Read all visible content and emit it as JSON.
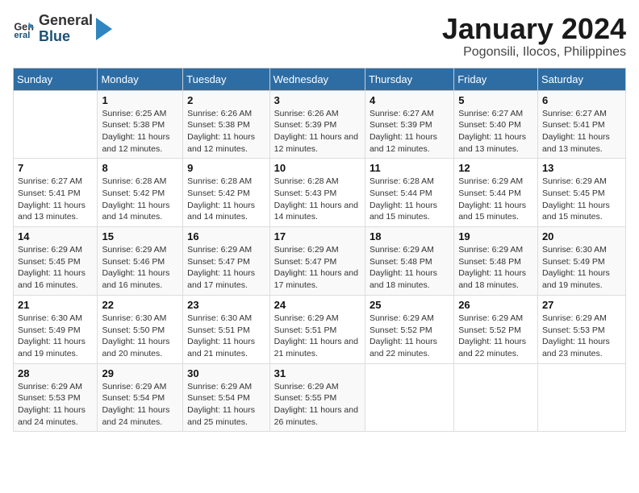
{
  "header": {
    "logo_general": "General",
    "logo_blue": "Blue",
    "month_title": "January 2024",
    "location": "Pogonsili, Ilocos, Philippines"
  },
  "days_of_week": [
    "Sunday",
    "Monday",
    "Tuesday",
    "Wednesday",
    "Thursday",
    "Friday",
    "Saturday"
  ],
  "weeks": [
    [
      {
        "day": "",
        "sunrise": "",
        "sunset": "",
        "daylight": ""
      },
      {
        "day": "1",
        "sunrise": "Sunrise: 6:25 AM",
        "sunset": "Sunset: 5:38 PM",
        "daylight": "Daylight: 11 hours and 12 minutes."
      },
      {
        "day": "2",
        "sunrise": "Sunrise: 6:26 AM",
        "sunset": "Sunset: 5:38 PM",
        "daylight": "Daylight: 11 hours and 12 minutes."
      },
      {
        "day": "3",
        "sunrise": "Sunrise: 6:26 AM",
        "sunset": "Sunset: 5:39 PM",
        "daylight": "Daylight: 11 hours and 12 minutes."
      },
      {
        "day": "4",
        "sunrise": "Sunrise: 6:27 AM",
        "sunset": "Sunset: 5:39 PM",
        "daylight": "Daylight: 11 hours and 12 minutes."
      },
      {
        "day": "5",
        "sunrise": "Sunrise: 6:27 AM",
        "sunset": "Sunset: 5:40 PM",
        "daylight": "Daylight: 11 hours and 13 minutes."
      },
      {
        "day": "6",
        "sunrise": "Sunrise: 6:27 AM",
        "sunset": "Sunset: 5:41 PM",
        "daylight": "Daylight: 11 hours and 13 minutes."
      }
    ],
    [
      {
        "day": "7",
        "sunrise": "Sunrise: 6:27 AM",
        "sunset": "Sunset: 5:41 PM",
        "daylight": "Daylight: 11 hours and 13 minutes."
      },
      {
        "day": "8",
        "sunrise": "Sunrise: 6:28 AM",
        "sunset": "Sunset: 5:42 PM",
        "daylight": "Daylight: 11 hours and 14 minutes."
      },
      {
        "day": "9",
        "sunrise": "Sunrise: 6:28 AM",
        "sunset": "Sunset: 5:42 PM",
        "daylight": "Daylight: 11 hours and 14 minutes."
      },
      {
        "day": "10",
        "sunrise": "Sunrise: 6:28 AM",
        "sunset": "Sunset: 5:43 PM",
        "daylight": "Daylight: 11 hours and 14 minutes."
      },
      {
        "day": "11",
        "sunrise": "Sunrise: 6:28 AM",
        "sunset": "Sunset: 5:44 PM",
        "daylight": "Daylight: 11 hours and 15 minutes."
      },
      {
        "day": "12",
        "sunrise": "Sunrise: 6:29 AM",
        "sunset": "Sunset: 5:44 PM",
        "daylight": "Daylight: 11 hours and 15 minutes."
      },
      {
        "day": "13",
        "sunrise": "Sunrise: 6:29 AM",
        "sunset": "Sunset: 5:45 PM",
        "daylight": "Daylight: 11 hours and 15 minutes."
      }
    ],
    [
      {
        "day": "14",
        "sunrise": "Sunrise: 6:29 AM",
        "sunset": "Sunset: 5:45 PM",
        "daylight": "Daylight: 11 hours and 16 minutes."
      },
      {
        "day": "15",
        "sunrise": "Sunrise: 6:29 AM",
        "sunset": "Sunset: 5:46 PM",
        "daylight": "Daylight: 11 hours and 16 minutes."
      },
      {
        "day": "16",
        "sunrise": "Sunrise: 6:29 AM",
        "sunset": "Sunset: 5:47 PM",
        "daylight": "Daylight: 11 hours and 17 minutes."
      },
      {
        "day": "17",
        "sunrise": "Sunrise: 6:29 AM",
        "sunset": "Sunset: 5:47 PM",
        "daylight": "Daylight: 11 hours and 17 minutes."
      },
      {
        "day": "18",
        "sunrise": "Sunrise: 6:29 AM",
        "sunset": "Sunset: 5:48 PM",
        "daylight": "Daylight: 11 hours and 18 minutes."
      },
      {
        "day": "19",
        "sunrise": "Sunrise: 6:29 AM",
        "sunset": "Sunset: 5:48 PM",
        "daylight": "Daylight: 11 hours and 18 minutes."
      },
      {
        "day": "20",
        "sunrise": "Sunrise: 6:30 AM",
        "sunset": "Sunset: 5:49 PM",
        "daylight": "Daylight: 11 hours and 19 minutes."
      }
    ],
    [
      {
        "day": "21",
        "sunrise": "Sunrise: 6:30 AM",
        "sunset": "Sunset: 5:49 PM",
        "daylight": "Daylight: 11 hours and 19 minutes."
      },
      {
        "day": "22",
        "sunrise": "Sunrise: 6:30 AM",
        "sunset": "Sunset: 5:50 PM",
        "daylight": "Daylight: 11 hours and 20 minutes."
      },
      {
        "day": "23",
        "sunrise": "Sunrise: 6:30 AM",
        "sunset": "Sunset: 5:51 PM",
        "daylight": "Daylight: 11 hours and 21 minutes."
      },
      {
        "day": "24",
        "sunrise": "Sunrise: 6:29 AM",
        "sunset": "Sunset: 5:51 PM",
        "daylight": "Daylight: 11 hours and 21 minutes."
      },
      {
        "day": "25",
        "sunrise": "Sunrise: 6:29 AM",
        "sunset": "Sunset: 5:52 PM",
        "daylight": "Daylight: 11 hours and 22 minutes."
      },
      {
        "day": "26",
        "sunrise": "Sunrise: 6:29 AM",
        "sunset": "Sunset: 5:52 PM",
        "daylight": "Daylight: 11 hours and 22 minutes."
      },
      {
        "day": "27",
        "sunrise": "Sunrise: 6:29 AM",
        "sunset": "Sunset: 5:53 PM",
        "daylight": "Daylight: 11 hours and 23 minutes."
      }
    ],
    [
      {
        "day": "28",
        "sunrise": "Sunrise: 6:29 AM",
        "sunset": "Sunset: 5:53 PM",
        "daylight": "Daylight: 11 hours and 24 minutes."
      },
      {
        "day": "29",
        "sunrise": "Sunrise: 6:29 AM",
        "sunset": "Sunset: 5:54 PM",
        "daylight": "Daylight: 11 hours and 24 minutes."
      },
      {
        "day": "30",
        "sunrise": "Sunrise: 6:29 AM",
        "sunset": "Sunset: 5:54 PM",
        "daylight": "Daylight: 11 hours and 25 minutes."
      },
      {
        "day": "31",
        "sunrise": "Sunrise: 6:29 AM",
        "sunset": "Sunset: 5:55 PM",
        "daylight": "Daylight: 11 hours and 26 minutes."
      },
      {
        "day": "",
        "sunrise": "",
        "sunset": "",
        "daylight": ""
      },
      {
        "day": "",
        "sunrise": "",
        "sunset": "",
        "daylight": ""
      },
      {
        "day": "",
        "sunrise": "",
        "sunset": "",
        "daylight": ""
      }
    ]
  ]
}
